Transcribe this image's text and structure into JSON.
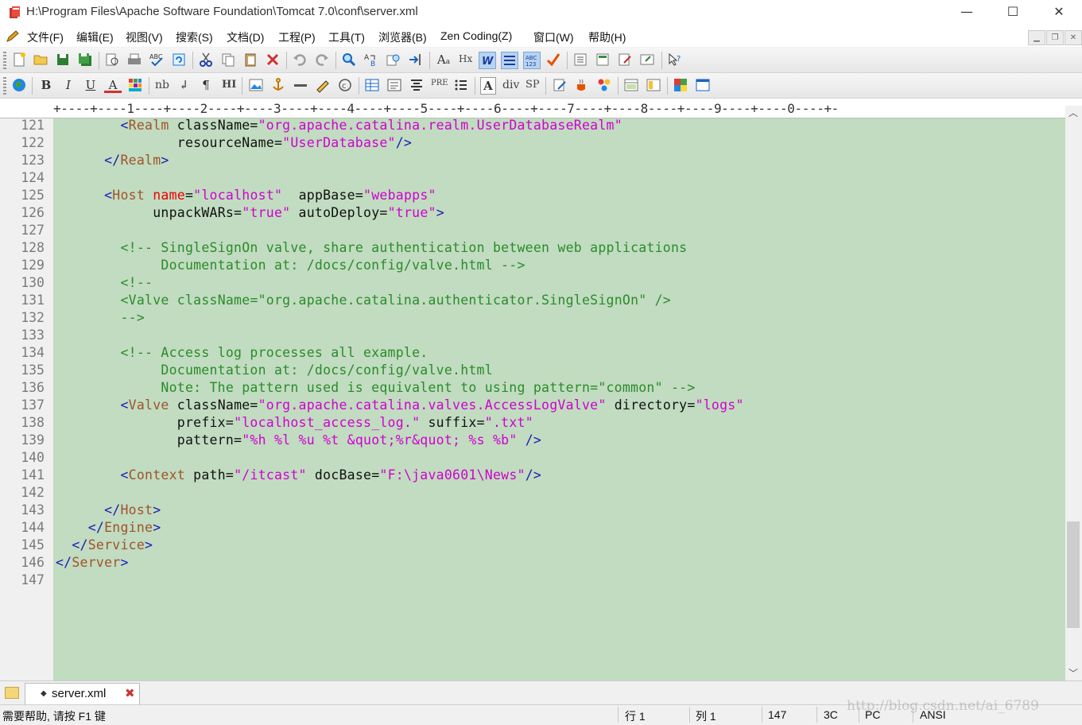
{
  "window": {
    "title": "H:\\Program Files\\Apache Software Foundation\\Tomcat 7.0\\conf\\server.xml",
    "minimize": "—",
    "maximize": "☐",
    "close": "✕"
  },
  "menu": {
    "items": [
      "文件(F)",
      "编辑(E)",
      "视图(V)",
      "搜索(S)",
      "文档(D)",
      "工程(P)",
      "工具(T)",
      "浏览器(B)",
      "Zen Coding(Z)",
      "窗口(W)",
      "帮助(H)"
    ],
    "mdi_min": "▁",
    "mdi_restore": "❐",
    "mdi_close": "✕"
  },
  "toolbar2": {
    "bold": "B",
    "italic": "I",
    "underline": "U",
    "font_color": "A",
    "nbsp": "nb",
    "pre": "PRE",
    "div": "div",
    "sp": "SP",
    "hx": "Hx",
    "hr": "HI"
  },
  "ruler": {
    "text": "+----+----1----+----2----+----3----+----4----+----5----+----6----+----7----+----8----+----9----+----0----+-"
  },
  "editor": {
    "line_numbers": [
      "121",
      "122",
      "123",
      "124",
      "125",
      "126",
      "127",
      "128",
      "129",
      "130",
      "131",
      "132",
      "133",
      "134",
      "135",
      "136",
      "137",
      "138",
      "139",
      "140",
      "141",
      "142",
      "143",
      "144",
      "145",
      "146",
      "147"
    ],
    "lines": [
      {
        "indent": "        ",
        "tokens": [
          [
            "t",
            "<"
          ],
          [
            "tn",
            "Realm"
          ],
          [
            "a",
            " className="
          ],
          [
            "s",
            "\"org.apache.catalina.realm.UserDatabaseRealm\""
          ]
        ]
      },
      {
        "indent": "               ",
        "tokens": [
          [
            "a",
            "resourceName="
          ],
          [
            "s",
            "\"UserDatabase\""
          ],
          [
            "t",
            "/>"
          ]
        ]
      },
      {
        "indent": "      ",
        "tokens": [
          [
            "t",
            "</"
          ],
          [
            "tn",
            "Realm"
          ],
          [
            "t",
            ">"
          ]
        ]
      },
      {
        "indent": "",
        "tokens": []
      },
      {
        "indent": "      ",
        "tokens": [
          [
            "t",
            "<"
          ],
          [
            "tn",
            "Host"
          ],
          [
            "a",
            " "
          ],
          [
            "ar",
            "name"
          ],
          [
            "a",
            "="
          ],
          [
            "s",
            "\"localhost\""
          ],
          [
            "a",
            "  appBase="
          ],
          [
            "s",
            "\"webapps\""
          ]
        ]
      },
      {
        "indent": "            ",
        "tokens": [
          [
            "a",
            "unpackWARs="
          ],
          [
            "s",
            "\"true\""
          ],
          [
            "a",
            " autoDeploy="
          ],
          [
            "s",
            "\"true\""
          ],
          [
            "t",
            ">"
          ]
        ]
      },
      {
        "indent": "",
        "tokens": []
      },
      {
        "indent": "        ",
        "tokens": [
          [
            "c",
            "<!-- SingleSignOn valve, share authentication between web applications"
          ]
        ]
      },
      {
        "indent": "             ",
        "tokens": [
          [
            "c",
            "Documentation at: /docs/config/valve.html -->"
          ]
        ]
      },
      {
        "indent": "        ",
        "tokens": [
          [
            "c",
            "<!--"
          ]
        ]
      },
      {
        "indent": "        ",
        "tokens": [
          [
            "c",
            "<Valve className=\"org.apache.catalina.authenticator.SingleSignOn\" />"
          ]
        ]
      },
      {
        "indent": "        ",
        "tokens": [
          [
            "c",
            "-->"
          ]
        ]
      },
      {
        "indent": "",
        "tokens": []
      },
      {
        "indent": "        ",
        "tokens": [
          [
            "c",
            "<!-- Access log processes all example."
          ]
        ]
      },
      {
        "indent": "             ",
        "tokens": [
          [
            "c",
            "Documentation at: /docs/config/valve.html"
          ]
        ]
      },
      {
        "indent": "             ",
        "tokens": [
          [
            "c",
            "Note: The pattern used is equivalent to using pattern=\"common\" -->"
          ]
        ]
      },
      {
        "indent": "        ",
        "tokens": [
          [
            "t",
            "<"
          ],
          [
            "tn",
            "Valve"
          ],
          [
            "a",
            " className="
          ],
          [
            "s",
            "\"org.apache.catalina.valves.AccessLogValve\""
          ],
          [
            "a",
            " directory="
          ],
          [
            "s",
            "\"logs\""
          ]
        ]
      },
      {
        "indent": "               ",
        "tokens": [
          [
            "a",
            "prefix="
          ],
          [
            "s",
            "\"localhost_access_log.\""
          ],
          [
            "a",
            " suffix="
          ],
          [
            "s",
            "\".txt\""
          ]
        ]
      },
      {
        "indent": "               ",
        "tokens": [
          [
            "a",
            "pattern="
          ],
          [
            "s",
            "\"%h %l %u %t &quot;%r&quot; %s %b\""
          ],
          [
            "a",
            " "
          ],
          [
            "t",
            "/>"
          ]
        ]
      },
      {
        "indent": "",
        "tokens": []
      },
      {
        "indent": "        ",
        "tokens": [
          [
            "t",
            "<"
          ],
          [
            "tn",
            "Context"
          ],
          [
            "a",
            " path="
          ],
          [
            "s",
            "\"/itcast\""
          ],
          [
            "a",
            " docBase="
          ],
          [
            "s",
            "\"F:\\java0601\\News\""
          ],
          [
            "t",
            "/>"
          ]
        ]
      },
      {
        "indent": "",
        "tokens": []
      },
      {
        "indent": "      ",
        "tokens": [
          [
            "t",
            "</"
          ],
          [
            "tn",
            "Host"
          ],
          [
            "t",
            ">"
          ]
        ]
      },
      {
        "indent": "    ",
        "tokens": [
          [
            "t",
            "</"
          ],
          [
            "tn",
            "Engine"
          ],
          [
            "t",
            ">"
          ]
        ]
      },
      {
        "indent": "  ",
        "tokens": [
          [
            "t",
            "</"
          ],
          [
            "tn",
            "Service"
          ],
          [
            "t",
            ">"
          ]
        ]
      },
      {
        "indent": "",
        "tokens": [
          [
            "t",
            "</"
          ],
          [
            "tn",
            "Server"
          ],
          [
            "t",
            ">"
          ]
        ]
      },
      {
        "indent": "",
        "tokens": []
      }
    ],
    "background": "#c1dcc0"
  },
  "tabs": [
    {
      "label": "server.xml",
      "close": "✖"
    }
  ],
  "status": {
    "help": "需要帮助, 请按 F1 键",
    "row": "行 1",
    "col": "列 1",
    "code": "147",
    "hex": "3C",
    "eol": "PC",
    "encoding": "ANSI"
  },
  "watermark": "http://blog.csdn.net/ai_6789"
}
